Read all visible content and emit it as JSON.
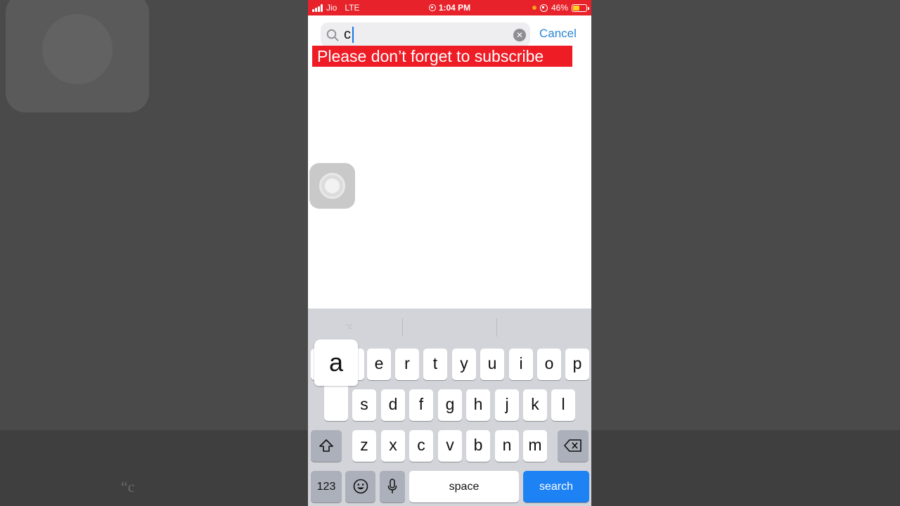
{
  "status_bar": {
    "carrier": "Jio",
    "network": "LTE",
    "time": "1:04 PM",
    "battery": "46%",
    "battery_level": 0.46,
    "bar_color": "#e8222a"
  },
  "search": {
    "value": "c",
    "cancel_label": "Cancel",
    "icon": "search-icon"
  },
  "banner": {
    "text": "Please don’t forget to subscribe",
    "color": "#ee1c25"
  },
  "keyboard": {
    "popup_key": "a",
    "row1": [
      "e",
      "r",
      "t",
      "y",
      "u",
      "i",
      "o",
      "p"
    ],
    "row2": [
      "s",
      "d",
      "f",
      "g",
      "h",
      "j",
      "k",
      "l"
    ],
    "row3": [
      "z",
      "x",
      "c",
      "v",
      "b",
      "n",
      "m"
    ],
    "numbers_label": "123",
    "space_label": "space",
    "search_label": "search",
    "predictive_first": "“c",
    "search_key_color": "#1d82f4"
  }
}
